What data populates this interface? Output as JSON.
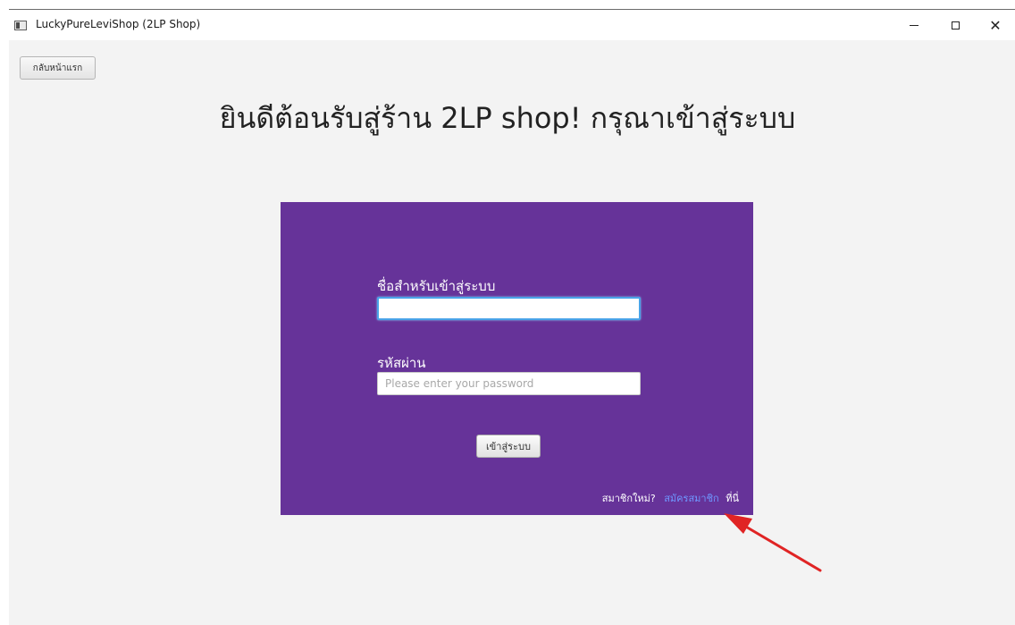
{
  "window": {
    "title": "LuckyPureLeviShop (2LP Shop)",
    "minimize_glyph": "",
    "maximize_glyph": "",
    "close_glyph": "✕"
  },
  "toolbar": {
    "back_label": "กลับหน้าแรก"
  },
  "page": {
    "title": "ยินดีต้อนรับสู่ร้าน 2LP shop! กรุณาเข้าสู่ระบบ"
  },
  "login": {
    "username_label": "ชื่อสำหรับเข้าสู่ระบบ",
    "username_value": "",
    "password_label": "รหัสผ่าน",
    "password_placeholder": "Please enter your password",
    "password_value": "",
    "submit_label": "เข้าสู่ระบบ",
    "signup_question": "สมาชิกใหม่?",
    "signup_link": "สมัครสมาชิก",
    "signup_suffix": "ที่นี่"
  },
  "colors": {
    "panel": "#663399",
    "link": "#6f97ff",
    "arrow": "#e02424",
    "focus": "#4aa3e8"
  },
  "icons": {
    "app": "app-window-icon",
    "minimize": "minimize-icon",
    "maximize": "maximize-icon",
    "close": "close-icon"
  }
}
